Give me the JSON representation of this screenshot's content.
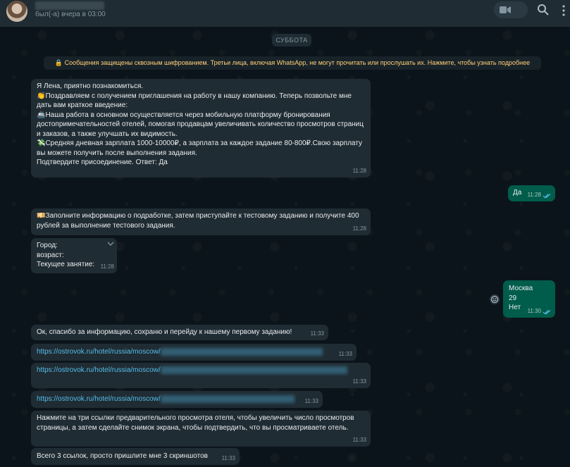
{
  "header": {
    "last_seen": "был(-а) вчера в 03:00"
  },
  "date_chip": "СУББОТА",
  "system_message": "🔒 Сообщения защищены сквозным шифрованием. Третьи лица, включая WhatsApp, не могут прочитать или прослушать их. Нажмите, чтобы узнать подробнее",
  "messages": [
    {
      "text": "Я Лена, приятно познакомиться.\n👏Поздравляем с получением приглашения на работу в нашу компанию. Теперь позвольте мне дать вам краткое введение:\n🚢Наша работа в основном осуществляется через мобильную платформу бронирования достопримечательностей отелей, помогая продавцам увеличивать количество просмотров страниц и заказов, а также улучшать их видимость.\n💸Средняя дневная зарплата 1000-10000₽, а зарплата за каждое задание 80-800₽.Свою зарплату вы можете получить после выполнения задания.\nПодтвердите присоединение. Ответ: Да",
      "time": "11:28"
    },
    {
      "text": "Да",
      "time": "11:28"
    },
    {
      "text": "💴Заполните информацию о подработке, затем приступайте к тестовому заданию и получите 400 рублей за выполнение тестового задания.",
      "time": "11:28"
    },
    {
      "text": "Город:\nвозраст:\nТекущее занятие:",
      "time": "11:28"
    },
    {
      "text": "Москва\n29\nНет",
      "time": "11:30"
    },
    {
      "text": "Ок, спасибо за информацию, сохраню и перейду к нашему первому заданию!",
      "time": "11:33"
    },
    {
      "text": "https://ostrovok.ru/hotel/russia/moscow/",
      "time": "11:33"
    },
    {
      "text": "https://ostrovok.ru/hotel/russia/moscow/",
      "time": "11:33"
    },
    {
      "text": "https://ostrovok.ru/hotel/russia/moscow/",
      "time": "11:33"
    },
    {
      "text": "Нажмите на три ссылки предварительного просмотра отеля, чтобы увеличить число просмотров страницы, а затем сделайте снимок экрана, чтобы подтвердить, что вы просматриваете отель.",
      "time": "11:33"
    },
    {
      "text": "Всего 3 ссылок, просто пришлите мне 3 скриншотов",
      "time": "11:33"
    }
  ],
  "icons": {
    "video": "video-call-icon",
    "search": "search-icon",
    "menu": "menu-icon",
    "read": "double-check-icon"
  },
  "colors": {
    "background": "#0b141a",
    "incoming": "#202c33",
    "outgoing": "#005c4b",
    "link": "#53bdeb",
    "system": "#ffd279",
    "read_tick": "#53bdeb"
  }
}
